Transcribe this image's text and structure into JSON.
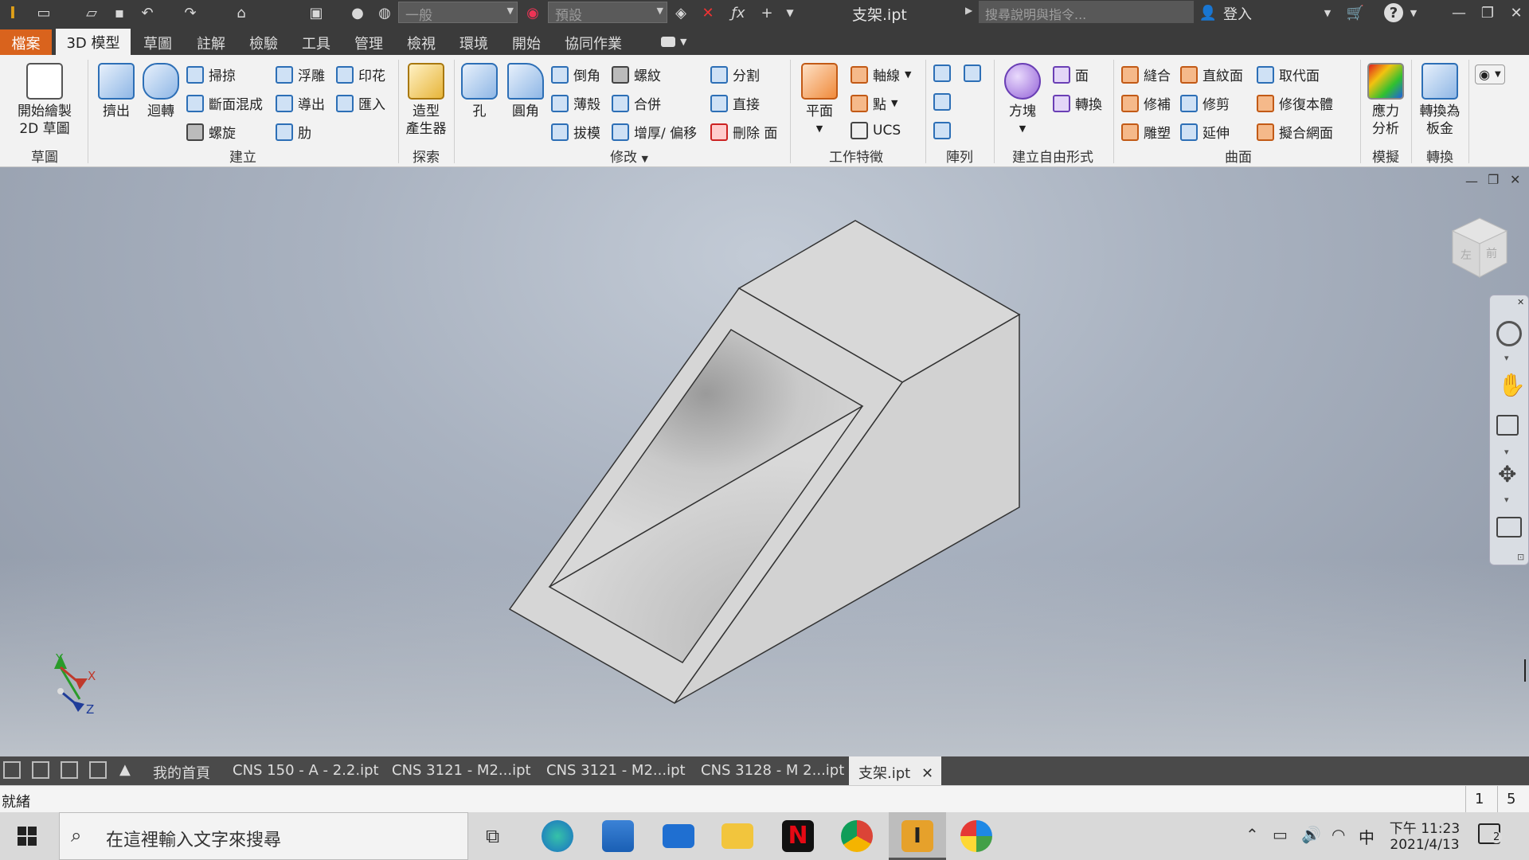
{
  "titlebar": {
    "style_combo": "一般",
    "material_combo": "預設",
    "filename": "支架.ipt",
    "search_placeholder": "搜尋說明與指令...",
    "sign_in": "登入"
  },
  "tabs": {
    "file": "檔案",
    "items": [
      "3D 模型",
      "草圖",
      "註解",
      "檢驗",
      "工具",
      "管理",
      "檢視",
      "環境",
      "開始",
      "協同作業"
    ]
  },
  "ribbon": {
    "sketch": {
      "start_label_1": "開始繪製",
      "start_label_2": "2D 草圖",
      "group": "草圖"
    },
    "create": {
      "extrude": "擠出",
      "revolve": "迴轉",
      "sweep": "掃掠",
      "loft": "斷面混成",
      "coil": "螺旋",
      "emboss": "浮雕",
      "derive": "導出",
      "rib": "肋",
      "decal": "印花",
      "import": "匯入",
      "group": "建立"
    },
    "explore": {
      "shape_gen_1": "造型",
      "shape_gen_2": "產生器",
      "group": "探索"
    },
    "modify": {
      "hole": "孔",
      "fillet": "圓角",
      "chamfer": "倒角",
      "shell": "薄殼",
      "draft": "拔模",
      "thread": "螺紋",
      "combine": "合併",
      "thicken": "增厚/ 偏移",
      "split": "分割",
      "direct": "直接",
      "delete_face": "刪除 面",
      "group": "修改"
    },
    "work_features": {
      "plane": "平面",
      "axis": "軸線",
      "point": "點",
      "ucs": "UCS",
      "group": "工作特徵"
    },
    "pattern": {
      "group": "陣列"
    },
    "freeform": {
      "box": "方塊",
      "face": "面",
      "convert": "轉換",
      "group": "建立自由形式"
    },
    "surface": {
      "stitch": "縫合",
      "patch": "修補",
      "sculpt": "雕塑",
      "ruled": "直紋面",
      "trim": "修剪",
      "extend": "延伸",
      "replace": "取代面",
      "repair": "修復本體",
      "fit_mesh": "擬合網面",
      "group": "曲面"
    },
    "simulation": {
      "stress_1": "應力",
      "stress_2": "分析",
      "group": "模擬"
    },
    "convert": {
      "sheet_1": "轉換為",
      "sheet_2": "板金",
      "group": "轉換"
    }
  },
  "viewcube": {
    "left": "左",
    "front": "前"
  },
  "triad": {
    "x": "X",
    "y": "Y",
    "z": "Z"
  },
  "doc_tabs": [
    "我的首頁",
    "CNS 150 - A - 2.2.ipt",
    "CNS 3121 - M2...ipt",
    "CNS 3121 - M2...ipt",
    "CNS 3128 - M 2...ipt",
    "支架.ipt"
  ],
  "status": {
    "text": "就緒",
    "n1": "1",
    "n2": "5"
  },
  "taskbar": {
    "search_placeholder": "在這裡輸入文字來搜尋",
    "time": "下午 11:23",
    "date": "2021/4/13",
    "ime": "中",
    "notifications": "2"
  }
}
